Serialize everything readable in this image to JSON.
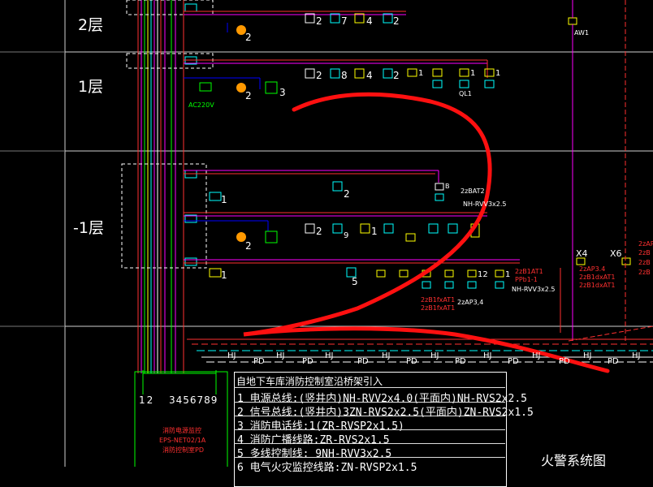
{
  "floors": {
    "f2": "2层",
    "f1": "1层",
    "b1": "-1层"
  },
  "device_counts": {
    "f2_a": "2",
    "f2_b": "2",
    "f2_c": "7",
    "f2_d": "4",
    "f2_e": "2",
    "f1_a": "2",
    "f1_b": "1",
    "f1_c": "3",
    "f1_d": "2",
    "f1_e": "8",
    "f1_f": "4",
    "f1_g": "2",
    "f1_h": "1",
    "f1_i": "1",
    "f1_j": "1",
    "b1_a": "2",
    "b1_b": "1",
    "b1_c": "2",
    "b1_d": "2",
    "b1_e": "9",
    "b1_f": "1",
    "b1_g": "1",
    "b1_h": "5",
    "b1_i": "1",
    "b1_j": "1",
    "b1_k": "1",
    "b1_l": "12",
    "b1_m": "1"
  },
  "tags": {
    "aw1": "AW1",
    "ql1": "QL1",
    "ac220": "AC220V",
    "x4": "X4",
    "x6": "X6",
    "zzap34_a": "2zAP3.4",
    "zzap34_b": "2zAP3,4",
    "zzap_right": "2zAP",
    "nh_rvv_a": "NH-RVV3x2.5",
    "nh_rvv_b": "NH-RVV3x2.5",
    "ppb": "PPb1-1",
    "at1_a": "2zB1AT1",
    "at1_b": "2zB1fxAT1",
    "at1_c": "2zB1dxAT1",
    "at1_d": "2zB1fxAT1",
    "at1_e": "2zB1dxAT1",
    "zb_right1": "2zB",
    "zb_right2": "2zB",
    "zb_right3": "2zB",
    "b_tag": "B",
    "zzbat2": "2zBAT2",
    "hj": "HJ",
    "pd": "PD"
  },
  "terminal_numbers": {
    "left": "12",
    "right": "3456789"
  },
  "legend": {
    "title": "自地下车库消防控制室沿桥架引入",
    "rows": [
      "1  电源总线:(竖井内)NH-RVV2x4.0(平面内)NH-RVS2x2.5",
      "2  信号总线:(竖井内)3ZN-RVS2x2.5(平面内)ZN-RVS2x1.5",
      "3  消防电话线:1(ZR-RVSP2x1.5)",
      "4  消防广播线路:ZR-RVS2x1.5",
      "5  多线控制线: 9NH-RVV3x2.5",
      "6  电气火灾监控线路:ZN-RVSP2x1.5"
    ]
  },
  "drawing_title": "火警系统图",
  "panel_note": {
    "line1": "消防电源监控",
    "line2": "EPS-NET02/1A",
    "line3": "消防控制室PD"
  },
  "colors": {
    "background": "#000000",
    "magenta": "#ff00ff",
    "red": "#ff0000",
    "green": "#00ff00",
    "cyan": "#00ffff",
    "yellow": "#ffff00",
    "white": "#ffffff",
    "blue": "#0000ff",
    "annotation_stroke": "#ff1010"
  }
}
